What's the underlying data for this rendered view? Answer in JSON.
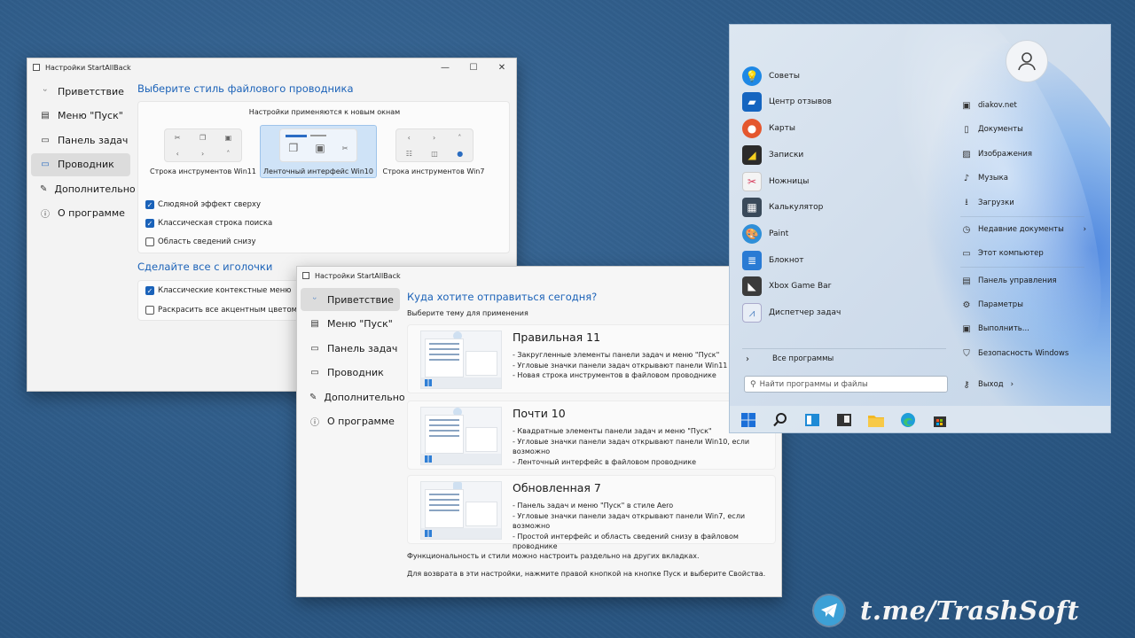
{
  "colors": {
    "accent": "#1b62b8",
    "desktop": "#2e5a86",
    "active_nav": "#dcdcdc"
  },
  "window1": {
    "title": "Настройки StartAllBack",
    "nav": [
      {
        "label": "Приветствие",
        "icon": "smile-icon"
      },
      {
        "label": "Меню \"Пуск\"",
        "icon": "start-menu-icon"
      },
      {
        "label": "Панель задач",
        "icon": "taskbar-icon"
      },
      {
        "label": "Проводник",
        "icon": "folder-icon"
      },
      {
        "label": "Дополнительно",
        "icon": "wrench-icon"
      },
      {
        "label": "О программе",
        "icon": "info-icon"
      }
    ],
    "active_nav": "Проводник",
    "section1_title": "Выберите стиль файлового проводника",
    "applies_note": "Настройки применяются к новым окнам",
    "toolbar_options": [
      {
        "label": "Строка инструментов Win11",
        "selected": false
      },
      {
        "label": "Ленточный интерфейс Win10",
        "selected": true
      },
      {
        "label": "Строка инструментов Win7",
        "selected": false
      }
    ],
    "checkboxes1": [
      {
        "label": "Слюдяной эффект сверху",
        "checked": true
      },
      {
        "label": "Классическая строка поиска",
        "checked": true
      },
      {
        "label": "Область сведений снизу",
        "checked": false
      }
    ],
    "section2_title": "Сделайте все с иголочки",
    "checkboxes2": [
      {
        "label": "Классические контекстные меню",
        "checked": true
      },
      {
        "label": "Раскрасить все акцентным цветом",
        "checked": false
      }
    ]
  },
  "window2": {
    "title": "Настройки StartAllBack",
    "nav": [
      {
        "label": "Приветствие",
        "icon": "smile-icon"
      },
      {
        "label": "Меню \"Пуск\"",
        "icon": "start-menu-icon"
      },
      {
        "label": "Панель задач",
        "icon": "taskbar-icon"
      },
      {
        "label": "Проводник",
        "icon": "folder-icon"
      },
      {
        "label": "Дополнительно",
        "icon": "wrench-icon"
      },
      {
        "label": "О программе",
        "icon": "info-icon"
      }
    ],
    "active_nav": "Приветствие",
    "heading": "Куда хотите отправиться сегодня?",
    "subheading": "Выберите тему для применения",
    "themes": [
      {
        "title": "Правильная 11",
        "bullets": [
          "- Закругленные элементы панели задач и меню \"Пуск\"",
          "- Угловые значки панели задач открывают панели Win11",
          "- Новая строка инструментов в файловом проводнике"
        ]
      },
      {
        "title": "Почти 10",
        "bullets": [
          "- Квадратные элементы панели задач и меню \"Пуск\"",
          "- Угловые значки панели задач открывают панели Win10, если возможно",
          "- Ленточный интерфейс в файловом проводнике"
        ]
      },
      {
        "title": "Обновленная 7",
        "bullets": [
          "- Панель задач и меню \"Пуск\" в стиле Aero",
          "- Угловые значки панели задач открывают панели Win7, если возможно",
          "- Простой интерфейс и область сведений снизу в файловом проводнике"
        ]
      }
    ],
    "footer1": "Функциональность и стили можно настроить раздельно на других вкладках.",
    "footer2": "Для возврата в эти настройки, нажмите правой кнопкой на кнопке Пуск и выберите Свойства."
  },
  "start_menu": {
    "programs": [
      {
        "label": "Советы",
        "icon": "tips-icon",
        "color": "#1e88e5"
      },
      {
        "label": "Центр отзывов",
        "icon": "feedback-hub-icon",
        "color": "#1565c0"
      },
      {
        "label": "Карты",
        "icon": "maps-icon",
        "color": "#e4572e"
      },
      {
        "label": "Записки",
        "icon": "sticky-notes-icon",
        "color": "#2b2b2b"
      },
      {
        "label": "Ножницы",
        "icon": "snipping-tool-icon",
        "color": "#d63a5a"
      },
      {
        "label": "Калькулятор",
        "icon": "calculator-icon",
        "color": "#3a4a5a"
      },
      {
        "label": "Paint",
        "icon": "paint-icon",
        "color": "#2f8fd8"
      },
      {
        "label": "Блокнот",
        "icon": "notepad-icon",
        "color": "#2a7bd4"
      },
      {
        "label": "Xbox Game Bar",
        "icon": "xbox-game-bar-icon",
        "color": "#3b3b3b"
      },
      {
        "label": "Диспетчер задач",
        "icon": "task-manager-icon",
        "color": "#5a8ac6"
      }
    ],
    "all_programs": "Все программы",
    "search_placeholder": "Найти программы и файлы",
    "places": [
      {
        "label": "diakov.net",
        "icon": "user-folder-icon"
      },
      {
        "label": "Документы",
        "icon": "documents-icon"
      },
      {
        "label": "Изображения",
        "icon": "pictures-icon"
      },
      {
        "label": "Музыка",
        "icon": "music-icon"
      },
      {
        "label": "Загрузки",
        "icon": "downloads-icon"
      },
      {
        "label": "Недавние документы",
        "icon": "recent-icon"
      },
      {
        "label": "Этот компьютер",
        "icon": "this-pc-icon"
      },
      {
        "label": "Панель управления",
        "icon": "control-panel-icon"
      },
      {
        "label": "Параметры",
        "icon": "settings-icon"
      },
      {
        "label": "Выполнить...",
        "icon": "run-icon"
      },
      {
        "label": "Безопасность Windows",
        "icon": "security-icon"
      }
    ],
    "logout": "Выход",
    "taskbar_icons": [
      "start-icon",
      "search-icon",
      "task-view-icon",
      "terminal-icon",
      "file-explorer-icon",
      "edge-icon",
      "store-icon"
    ]
  },
  "watermark": "t.me/TrashSoft"
}
